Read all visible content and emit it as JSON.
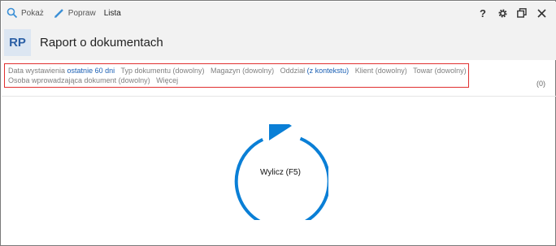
{
  "toolbar": {
    "show_label": "Pokaż",
    "fix_label": "Popraw",
    "list_label": "Lista",
    "help_label": "?"
  },
  "header": {
    "badge": "RP",
    "title": "Raport o dokumentach"
  },
  "filters": {
    "items": [
      {
        "label": "Data wystawienia",
        "value": "ostatnie 60 dni"
      },
      {
        "label": "Typ dokumentu",
        "value": "(dowolny)"
      },
      {
        "label": "Magazyn",
        "value": "(dowolny)"
      },
      {
        "label": "Oddział",
        "value": "(z kontekstu)"
      },
      {
        "label": "Klient",
        "value": "(dowolny)"
      },
      {
        "label": "Towar",
        "value": "(dowolny)"
      },
      {
        "label": "Osoba wprowadzająca dokument",
        "value": "(dowolny)"
      }
    ],
    "more_label": "Więcej",
    "count": "(0)"
  },
  "compute": {
    "label": "Wylicz (F5)"
  },
  "colors": {
    "accent": "#0a7fd6",
    "link": "#1a5fb4",
    "toolbar_bg": "#f2f2f2",
    "highlight_border": "#e03030"
  },
  "icons": {
    "show": "search-icon",
    "fix": "pencil-icon",
    "settings": "gear-icon",
    "restore": "restore-window-icon",
    "close": "close-icon",
    "compute": "play-refresh-icon"
  }
}
